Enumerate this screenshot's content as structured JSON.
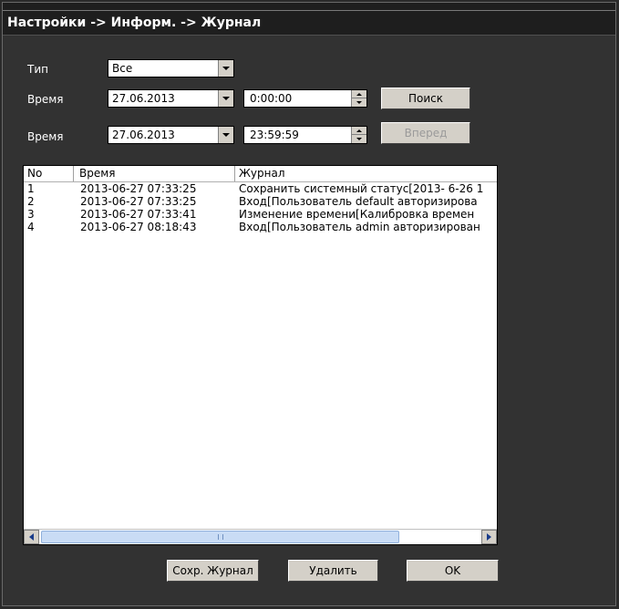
{
  "window": {
    "title": "Настройки -> Информ. -> Журнал"
  },
  "filters": {
    "type_label": "Тип",
    "type_value": "Все",
    "time_label_1": "Время",
    "date_from": "27.06.2013",
    "time_from": "0:00:00",
    "time_label_2": "Время",
    "date_to": "27.06.2013",
    "time_to": "23:59:59",
    "search_label": "Поиск",
    "forward_label": "Вперед"
  },
  "log_table": {
    "columns": [
      "No",
      "Время",
      "Журнал"
    ],
    "rows": [
      {
        "no": "1",
        "time": "2013-06-27 07:33:25",
        "entry": "Сохранить системный статус[2013- 6-26 1"
      },
      {
        "no": "2",
        "time": "2013-06-27 07:33:25",
        "entry": "Вход[Пользователь default авторизирова"
      },
      {
        "no": "3",
        "time": "2013-06-27 07:33:41",
        "entry": "Изменение времени[Калибровка времен"
      },
      {
        "no": "4",
        "time": "2013-06-27 08:18:43",
        "entry": "Вход[Пользователь admin авторизирован"
      }
    ]
  },
  "footer": {
    "save_label": "Сохр. Журнал",
    "delete_label": "Удалить",
    "ok_label": "OK"
  },
  "icons": {
    "dropdown": "chevron-down-icon",
    "spin_up": "spin-up-icon",
    "spin_down": "spin-down-icon",
    "scroll_left": "scroll-left-icon",
    "scroll_right": "scroll-right-icon"
  }
}
